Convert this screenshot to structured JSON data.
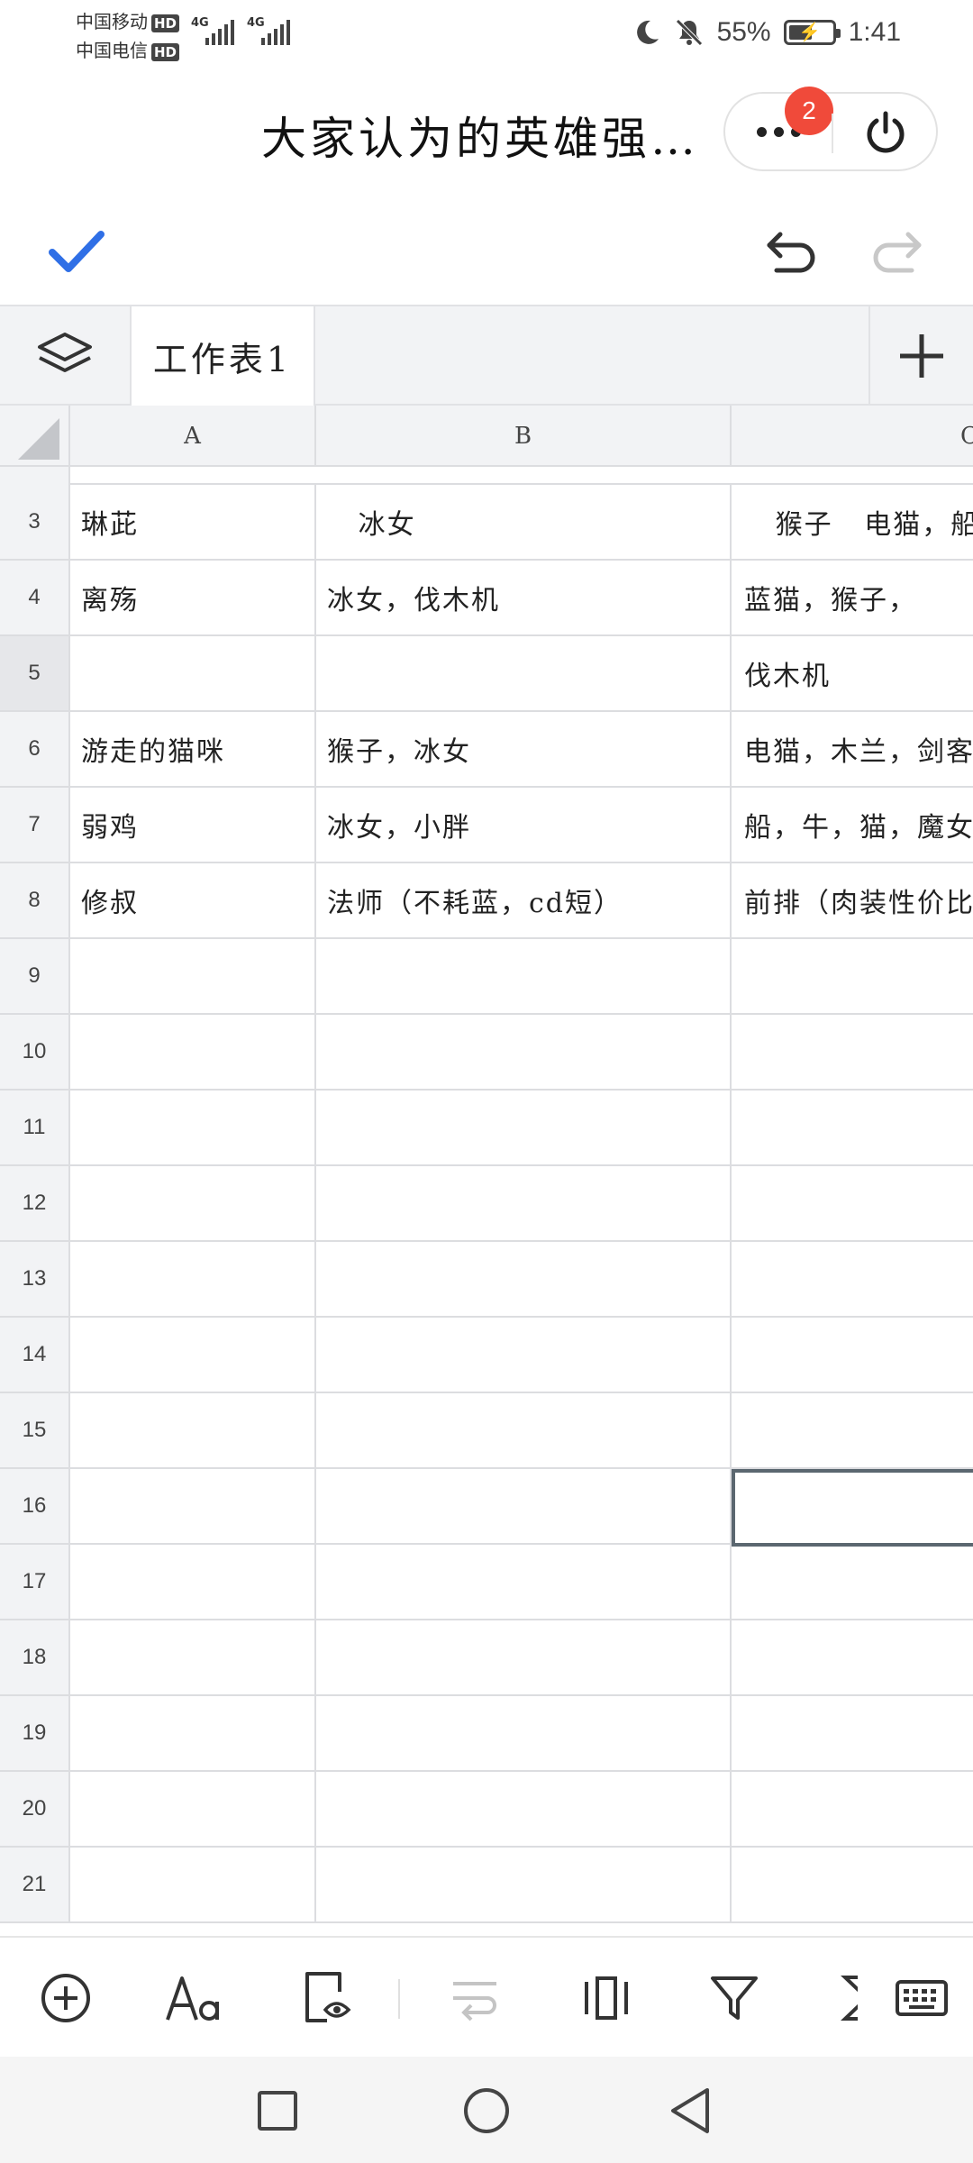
{
  "status_bar": {
    "carrier_1": "中国移动",
    "carrier_2": "中国电信",
    "hd_label": "HD",
    "network_1": "4G",
    "network_2": "4G",
    "battery": "55%",
    "battery_level": 0.55,
    "time": "1:41",
    "icons": [
      "moon-icon",
      "mute-bell-icon",
      "battery-charging-icon"
    ]
  },
  "header": {
    "title": "大家认为的英雄强…",
    "notification_count": "2"
  },
  "sheet_tabs": {
    "active_tab": "工作表1"
  },
  "grid": {
    "columns": [
      "A",
      "B",
      "C"
    ],
    "rows": [
      {
        "num": "3",
        "a": "琳茈",
        "b": "   冰女",
        "c": "   猴子   电猫，船"
      },
      {
        "num": "4",
        "a": "离殇",
        "b": "冰女，伐木机",
        "c": "蓝猫，猴子，"
      },
      {
        "num": "5",
        "a": "",
        "b": "",
        "c": "伐木机"
      },
      {
        "num": "6",
        "a": "游走的猫咪",
        "b": "猴子，冰女",
        "c": "电猫，木兰，剑客"
      },
      {
        "num": "7",
        "a": "弱鸡",
        "b": "冰女，小胖",
        "c": "船，牛，猫，魔女"
      },
      {
        "num": "8",
        "a": "修叔",
        "b": "法师（不耗蓝，cd短）",
        "c": "前排（肉装性价比"
      },
      {
        "num": "9",
        "a": "",
        "b": "",
        "c": ""
      },
      {
        "num": "10",
        "a": "",
        "b": "",
        "c": ""
      },
      {
        "num": "11",
        "a": "",
        "b": "",
        "c": ""
      },
      {
        "num": "12",
        "a": "",
        "b": "",
        "c": ""
      },
      {
        "num": "13",
        "a": "",
        "b": "",
        "c": ""
      },
      {
        "num": "14",
        "a": "",
        "b": "",
        "c": ""
      },
      {
        "num": "15",
        "a": "",
        "b": "",
        "c": ""
      },
      {
        "num": "16",
        "a": "",
        "b": "",
        "c": ""
      },
      {
        "num": "17",
        "a": "",
        "b": "",
        "c": ""
      },
      {
        "num": "18",
        "a": "",
        "b": "",
        "c": ""
      },
      {
        "num": "19",
        "a": "",
        "b": "",
        "c": ""
      },
      {
        "num": "20",
        "a": "",
        "b": "",
        "c": ""
      },
      {
        "num": "21",
        "a": "",
        "b": "",
        "c": ""
      }
    ],
    "selected_cell": "C16"
  },
  "theme": {
    "accent": "#2f6fe6",
    "badge": "#f04a3a",
    "header_bg": "#f2f3f5",
    "grid_line": "#dcdde0"
  }
}
